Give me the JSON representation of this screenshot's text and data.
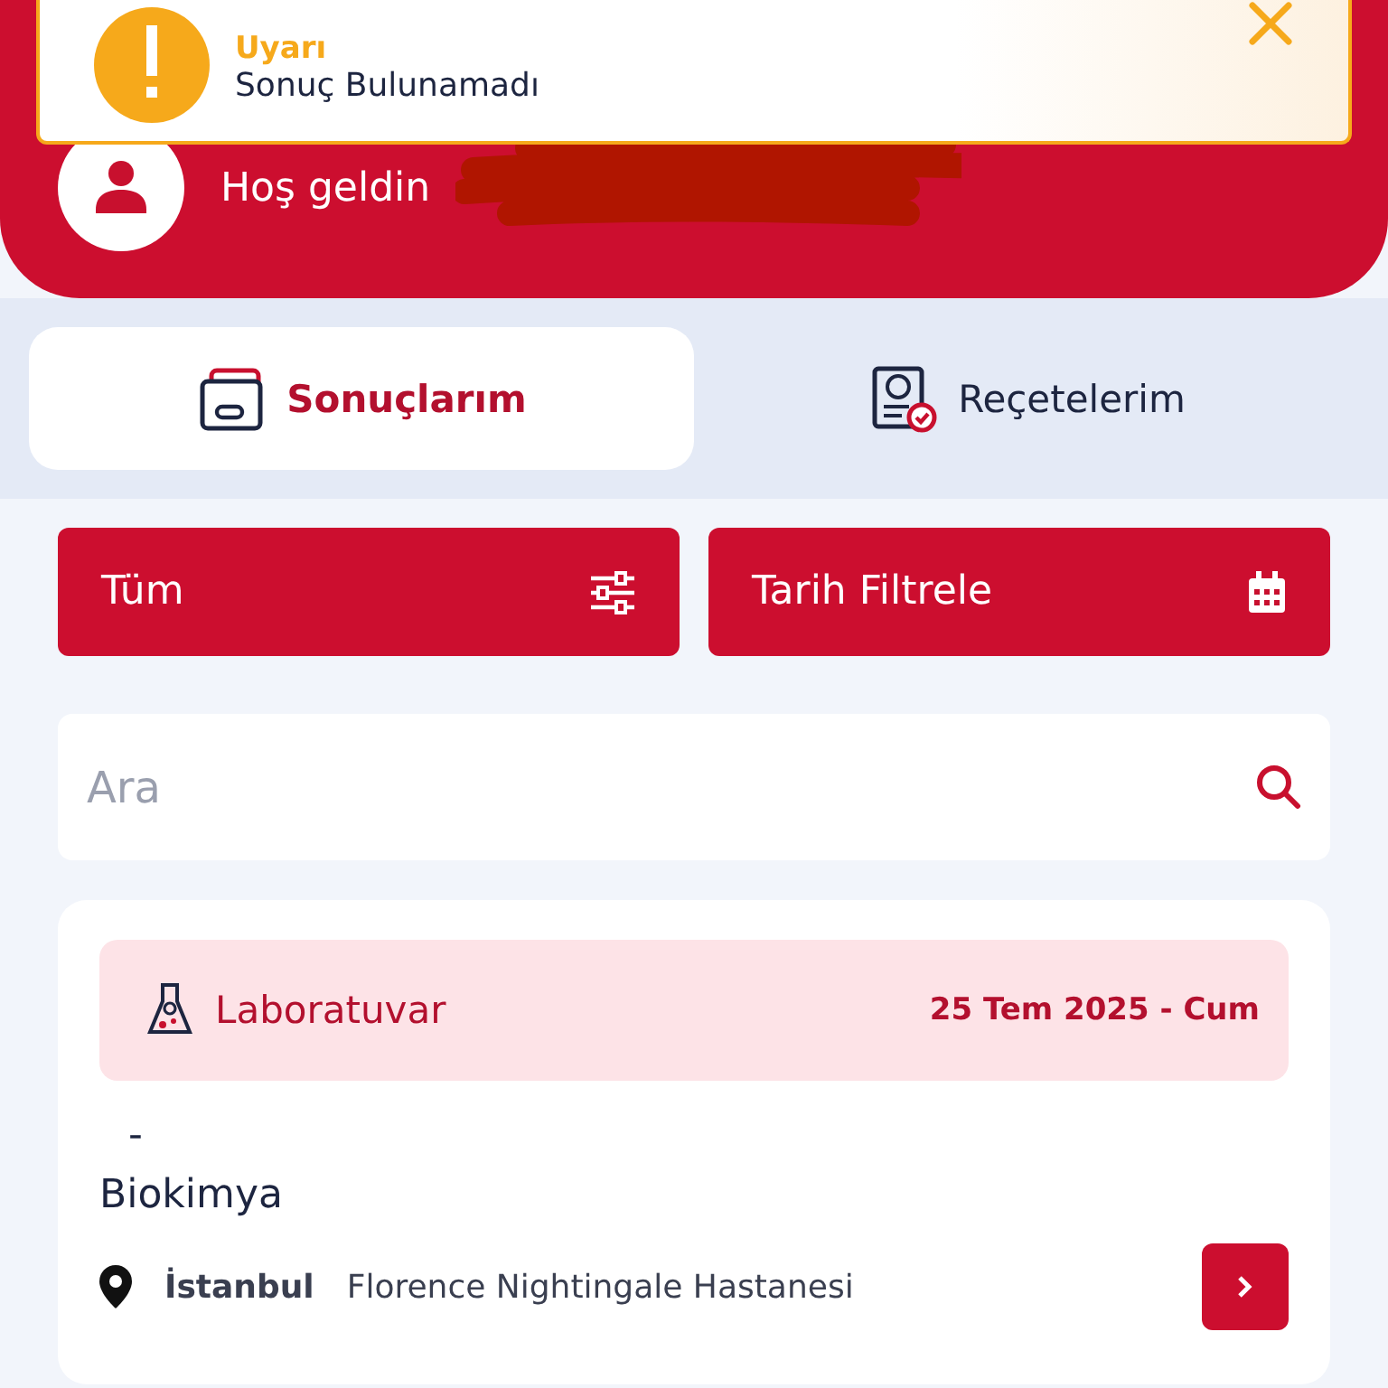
{
  "toast": {
    "title": "Uyarı",
    "message": "Sonuç Bulunamadı"
  },
  "header": {
    "greeting": "Hoş geldin"
  },
  "tabs": [
    {
      "label": "Sonuçlarım",
      "selected": true,
      "kind": "results"
    },
    {
      "label": "Reçetelerim",
      "selected": false,
      "kind": "prescriptions"
    }
  ],
  "filters": [
    {
      "label": "Tüm",
      "kind": "sliders"
    },
    {
      "label": "Tarih Filtrele",
      "kind": "calendar"
    }
  ],
  "search": {
    "placeholder": "Ara"
  },
  "results": [
    {
      "category": "Laboratuvar",
      "date": "25 Tem 2025 - Cum",
      "dash": "-",
      "test": "Biokimya",
      "city": "İstanbul",
      "hospital": "Florence Nightingale Hastanesi"
    }
  ]
}
